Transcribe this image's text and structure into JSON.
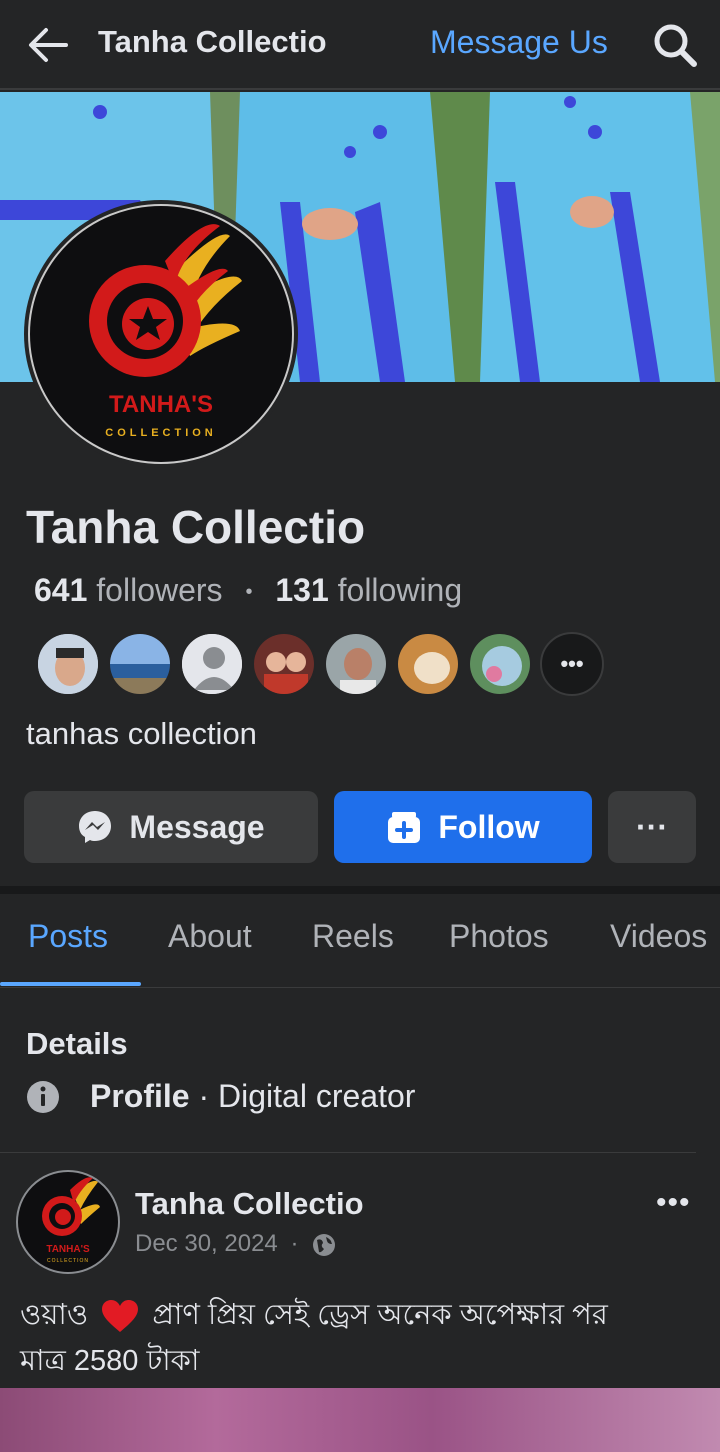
{
  "topbar": {
    "title": "Tanha Collectio",
    "message_us": "Message Us"
  },
  "profile": {
    "name": "Tanha Collectio",
    "followers_count": "641",
    "followers_label": "followers",
    "following_count": "131",
    "following_label": "following",
    "bio": "tanhas collection",
    "logo_text": "TANHA'S",
    "logo_sub": "COLLECTION"
  },
  "actions": {
    "message": "Message",
    "follow": "Follow",
    "more": "···"
  },
  "tabs": [
    "Posts",
    "About",
    "Reels",
    "Photos",
    "Videos"
  ],
  "details": {
    "title": "Details",
    "label": "Profile",
    "value": "· Digital creator"
  },
  "post": {
    "author": "Tanha Collectio",
    "date": "Dec 30, 2024",
    "dot": "·",
    "more": "•••",
    "text_line1_start": "ওয়াও",
    "text_line1_rest": "প্রাণ প্রিয় সেই ড্রেস অনেক অপেক্ষার পর",
    "text_line2": "মাত্র 2580 টাকা"
  },
  "colors": {
    "accent": "#1f6feb",
    "link": "#5aa7ff",
    "bg": "#242526"
  }
}
